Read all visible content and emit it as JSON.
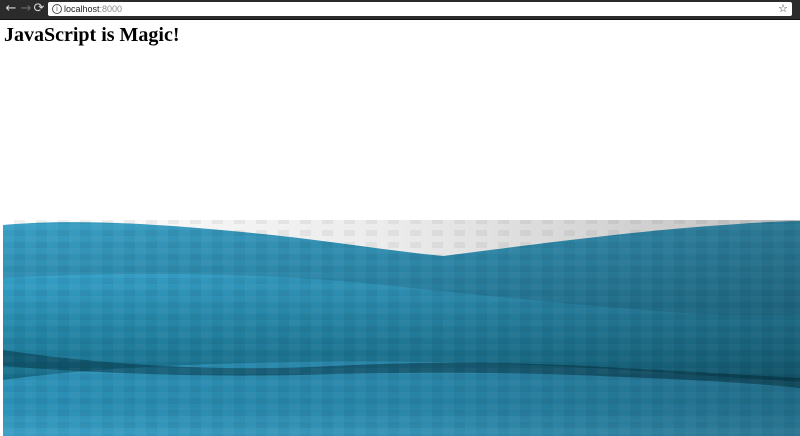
{
  "browser": {
    "back_icon": "←",
    "forward_icon": "→",
    "reload_icon": "⟳",
    "info_icon": "i",
    "url_host": "localhost",
    "url_port": ":8000",
    "bookmark_icon": "☆"
  },
  "page": {
    "heading": "JavaScript is Magic!"
  },
  "scene": {
    "colors": {
      "sky": "#ffffff",
      "water_light": "#3ba0c6",
      "water_mid": "#1f7fa3",
      "water_dark": "#0b4f68",
      "water_deep": "#073a4d"
    }
  }
}
